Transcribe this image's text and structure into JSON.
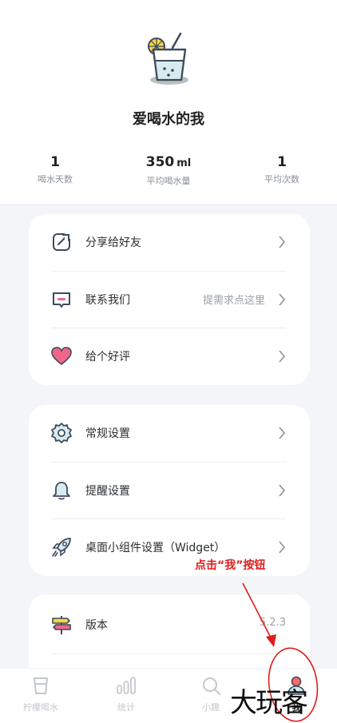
{
  "profile": {
    "nickname": "爱喝水的我",
    "stats": [
      {
        "value": "1",
        "unit": "",
        "label": "喝水天数"
      },
      {
        "value": "350",
        "unit": "ml",
        "label": "平均喝水量"
      },
      {
        "value": "1",
        "unit": "",
        "label": "平均次数"
      }
    ]
  },
  "menu_group_1": {
    "items": [
      {
        "label": "分享给好友",
        "hint": "",
        "icon": "share-icon"
      },
      {
        "label": "联系我们",
        "hint": "提需求点这里",
        "icon": "message-icon"
      },
      {
        "label": "给个好评",
        "hint": "",
        "icon": "heart-icon"
      }
    ]
  },
  "menu_group_2": {
    "items": [
      {
        "label": "常规设置",
        "icon": "gear-icon"
      },
      {
        "label": "提醒设置",
        "icon": "bell-icon"
      },
      {
        "label": "桌面小组件设置（Widget）",
        "icon": "rocket-icon"
      }
    ]
  },
  "menu_group_3": {
    "items": [
      {
        "label": "版本",
        "value": "5.2.3",
        "icon": "signpost-icon"
      }
    ]
  },
  "tabbar": {
    "tabs": [
      {
        "label": "柠檬喝水",
        "icon": "cup-icon",
        "active": false
      },
      {
        "label": "统计",
        "icon": "bar-chart-icon",
        "active": false
      },
      {
        "label": "小趣",
        "icon": "search-icon",
        "active": false
      },
      {
        "label": "我",
        "icon": "person-icon",
        "active": true
      }
    ]
  },
  "annotation": {
    "text": "点击“我”按钮",
    "color": "#e21b1b"
  },
  "watermark": {
    "text": "大玩客"
  },
  "colors": {
    "accent": "#3f4a5a",
    "heart": "#f0668a",
    "highlight": "#ff6b6b"
  }
}
